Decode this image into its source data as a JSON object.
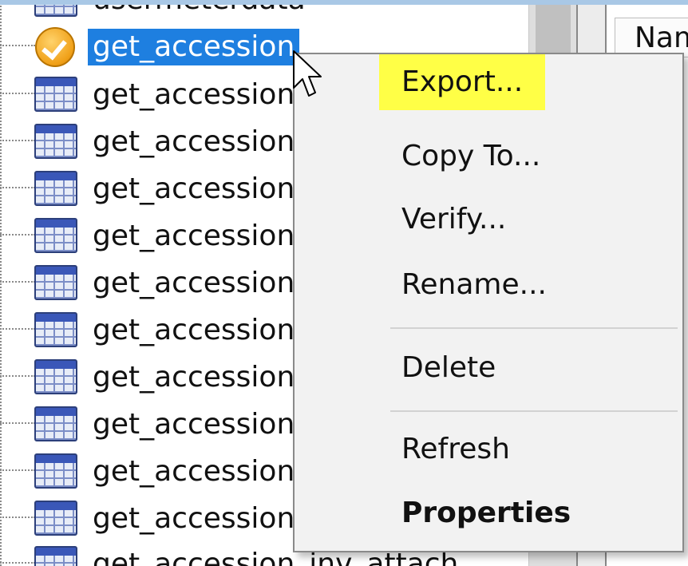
{
  "tree": {
    "partial_top": "usermeterdata",
    "selected": "get_accession",
    "truncated_item": "get_accession",
    "partial_bottom": "get_accession_inv_attach",
    "truncated_count": 11
  },
  "right_panel": {
    "header": "Name"
  },
  "context_menu": {
    "items": [
      {
        "label": "Export...",
        "highlighted": true
      },
      {
        "label": "Copy To..."
      },
      {
        "label": "Verify..."
      },
      {
        "label": "Rename..."
      },
      {
        "label": "Delete"
      },
      {
        "label": "Refresh"
      },
      {
        "label": "Properties",
        "bold": true
      }
    ]
  },
  "colors": {
    "selection": "#1e7fe0",
    "highlight": "#ffff46",
    "menu_bg": "#f2f2f2",
    "frame_bg": "#a9c8e6"
  },
  "icons": [
    "table-icon",
    "checkmark-icon",
    "mouse-pointer-icon"
  ]
}
